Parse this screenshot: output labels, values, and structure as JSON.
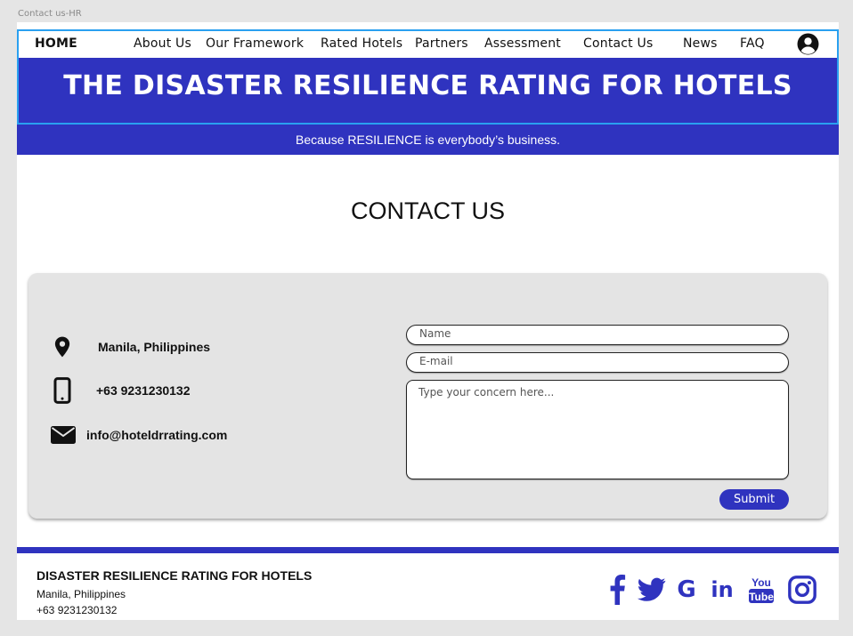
{
  "frame_label": "Contact us-HR",
  "nav": {
    "items": [
      {
        "label": "HOME"
      },
      {
        "label": "About Us"
      },
      {
        "label": "Our Framework"
      },
      {
        "label": "Rated Hotels"
      },
      {
        "label": "Partners"
      },
      {
        "label": "Assessment"
      },
      {
        "label": "Contact Us"
      },
      {
        "label": "News"
      },
      {
        "label": "FAQ"
      }
    ],
    "avatar_icon": "user-circle-icon"
  },
  "banner": {
    "title": "THE DISASTER RESILIENCE RATING FOR HOTELS",
    "tagline": "Because RESILIENCE is everybody’s business."
  },
  "contact": {
    "heading": "CONTACT US",
    "info": [
      {
        "icon": "map-pin-icon",
        "text": "Manila, Philippines"
      },
      {
        "icon": "phone-icon",
        "text": "+63 9231230132"
      },
      {
        "icon": "envelope-icon",
        "text": "info@hoteldrrating.com"
      }
    ],
    "form": {
      "name_placeholder": "Name",
      "email_placeholder": "E-mail",
      "concern_placeholder": "Type your concern here...",
      "submit_label": "Submit"
    }
  },
  "footer": {
    "title": "DISASTER RESILIENCE RATING FOR HOTELS",
    "address": "Manila, Philippines",
    "phone": "+63 9231230132",
    "social": [
      {
        "icon": "facebook-icon"
      },
      {
        "icon": "twitter-icon"
      },
      {
        "icon": "google-icon"
      },
      {
        "icon": "linkedin-icon"
      },
      {
        "icon": "youtube-icon"
      },
      {
        "icon": "instagram-icon"
      }
    ]
  },
  "colors": {
    "brand": "#2f33bf",
    "nav_border": "#2aa0f0",
    "card_bg": "#e4e4e4",
    "page_bg": "#e5e5e5"
  }
}
